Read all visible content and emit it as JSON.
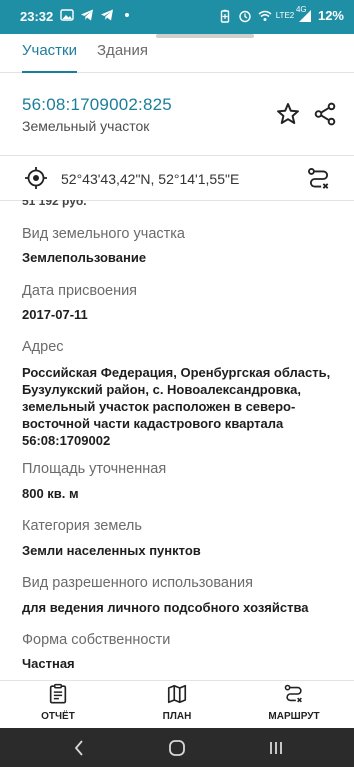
{
  "status_bar": {
    "time": "23:32",
    "battery": "12%",
    "icons_left": [
      "image-icon",
      "telegram-icon",
      "telegram-icon",
      "dot-icon"
    ],
    "icons_right": [
      "battery-saver-icon",
      "alarm-icon",
      "wifi-icon",
      "volte-icon",
      "signal-icon",
      "battery-icon"
    ],
    "network_tag": "4G",
    "volte_tag": "LTE2",
    "background": "#1f8fa5"
  },
  "tabs": [
    {
      "label": "Участки",
      "active": true
    },
    {
      "label": "Здания",
      "active": false
    }
  ],
  "header": {
    "cadastral_number": "56:08:1709002:825",
    "object_type": "Земельный участок"
  },
  "coordinates": "52°43'43,42\"N, 52°14'1,55\"E",
  "content": {
    "truncated_text": "51 192 руб.",
    "fields": [
      {
        "label": "Вид земельного участка",
        "value": "Землепользование"
      },
      {
        "label": "Дата присвоения",
        "value": "2017-07-11"
      },
      {
        "label": "Адрес",
        "value": "Российская Федерация, Оренбургская область, Бузулукский район, с. Новоалександровка, земельный участок расположен в северо-восточной части кадастрового квартала 56:08:1709002"
      },
      {
        "label": "Площадь уточненная",
        "value": "800 кв. м"
      },
      {
        "label": "Категория земель",
        "value": "Земли населенных пунктов"
      },
      {
        "label": "Вид разрешенного использования",
        "value": "для ведения личного подсобного хозяйства"
      },
      {
        "label": "Форма собственности",
        "value": "Частная"
      }
    ]
  },
  "bottom_nav": [
    {
      "label": "ОТЧЁТ",
      "icon": "report-icon"
    },
    {
      "label": "ПЛАН",
      "icon": "map-icon"
    },
    {
      "label": "МАРШРУТ",
      "icon": "route-icon"
    }
  ],
  "colors": {
    "accent": "#1c7f99",
    "label_gray": "#6b6b6b",
    "system_nav": "#2b2b2b"
  }
}
